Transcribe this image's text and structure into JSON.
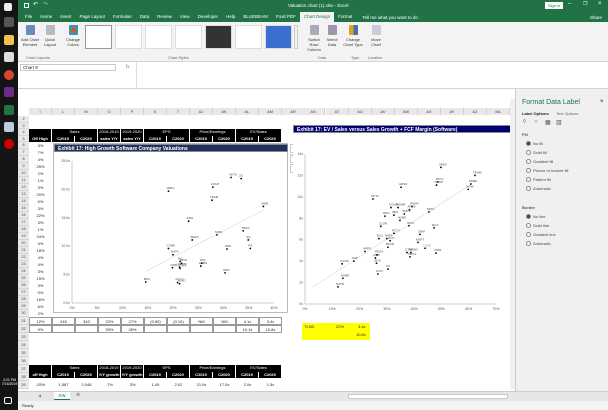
{
  "window": {
    "title": "Valuation chart (1).xlsx - Excel",
    "signin": "Sign in",
    "share": "Share"
  },
  "taskbar": {
    "time": "3:21 PM",
    "date": "7/16/2019"
  },
  "tabs": [
    "File",
    "Home",
    "Insert",
    "Page Layout",
    "Formulas",
    "Data",
    "Review",
    "View",
    "Developer",
    "Help",
    "BLUEBEAM",
    "Foxit PDF",
    "Chart Design",
    "Format"
  ],
  "active_tab": "Chart Design",
  "tell_me": "Tell me what you want to do",
  "ribbon": {
    "add_chart_element": "Add Chart Element",
    "quick_layout": "Quick Layout",
    "change_colors": "Change Colors",
    "switch_row_col": "Switch Row/ Column",
    "select_data": "Select Data",
    "change_chart_type": "Change Chart Type",
    "move_chart": "Move Chart",
    "groups": {
      "layouts": "Chart Layouts",
      "styles": "Chart Styles",
      "data": "Data",
      "type": "Type",
      "location": "Location"
    }
  },
  "formula": {
    "name_box": "Chart 9",
    "fx": "fx"
  },
  "columns_left": [
    "I",
    "L",
    "M",
    "O",
    "P",
    "S",
    "T",
    "AJ",
    "AK",
    "AL",
    "AM",
    "AR"
  ],
  "columns_right": [
    "AS",
    "AT",
    "AU",
    "AV",
    "AW",
    "AX",
    "AY",
    "AZ",
    "BA"
  ],
  "table_top": {
    "groups": [
      "",
      "Sales",
      "2018-2019",
      "2019-2020",
      "EPS",
      "Price/Earnings",
      "EV/Sales"
    ],
    "headers": [
      "Off High",
      "C2019",
      "C2020",
      "sales Y/Y",
      "sales Y/Y",
      "C2019",
      "C2020",
      "C2019",
      "C2020",
      "C2019",
      "C2020"
    ]
  },
  "off_high": [
    "3%",
    "7%",
    "4%",
    "25%",
    "2%",
    "1%",
    "3%",
    "20%",
    "0%",
    "3%",
    "22%",
    "3%",
    "1%",
    "24%",
    "4%",
    "18%",
    "4%",
    "4%",
    "3%",
    "15%",
    "3%",
    "0%",
    "16%",
    "6%",
    "2%"
  ],
  "row31": [
    "12%",
    "245",
    "343",
    "22%",
    "27%",
    "(0.90)",
    "(0.10)",
    "NM",
    "NM",
    "4.1x",
    "3.4x"
  ],
  "row32": [
    "9%",
    "",
    "",
    "33%",
    "26%",
    "",
    "",
    "",
    "",
    "10.1x",
    "10.8x"
  ],
  "table_bottom": {
    "groups": [
      "",
      "Sales",
      "2018-2019",
      "2019-2020",
      "EPS",
      "Price/Earnings",
      "EV/Sales"
    ],
    "headers": [
      "off High",
      "C2019",
      "C2020",
      "Y/Y growth",
      "Y/Y growth",
      "C2019",
      "C2020",
      "C2019",
      "C2020",
      "C2019",
      "C2020"
    ],
    "row": [
      "-25%",
      "1,587",
      "2,048",
      "-7%",
      "3%",
      "1.49",
      "2.02",
      "21.9x",
      "17.0x",
      "2.0x",
      "1.5x"
    ]
  },
  "highlight": {
    "ticker": "TLND",
    "growth": "22%",
    "ev1": "3.4x",
    "ev2": "10.8x",
    "color": "#ffff00"
  },
  "chart_data": [
    {
      "type": "scatter",
      "title": "Exhibit 17: High Growth Software Company Valuations",
      "xlim": [
        0,
        40
      ],
      "ylim": [
        0,
        25
      ],
      "xticks": [
        "0%",
        "5%",
        "10%",
        "15%",
        "20%",
        "25%",
        "30%",
        "35%",
        "40%"
      ],
      "yticks": [
        "0.0x",
        "5.0x",
        "10.0x",
        "15.0x",
        "20.0x",
        "25.0x"
      ],
      "points": [
        {
          "label": "VEEV",
          "x": 19.1,
          "y": 19.7
        },
        {
          "label": "OKTA",
          "x": 31.5,
          "y": 22.1
        },
        {
          "label": "ZS",
          "x": 33.5,
          "y": 21.9
        },
        {
          "label": "COUP",
          "x": 27.9,
          "y": 20.4
        },
        {
          "label": "TEAM",
          "x": 27.7,
          "y": 18.1
        },
        {
          "label": "MDB",
          "x": 37.9,
          "y": 17.0
        },
        {
          "label": "RNG",
          "x": 23.1,
          "y": 14.4
        },
        {
          "label": "NOW",
          "x": 28.7,
          "y": 12.0
        },
        {
          "label": "TWLO",
          "x": 33.9,
          "y": 12.7
        },
        {
          "label": "SQ",
          "x": 34.9,
          "y": 11.1
        },
        {
          "label": "PS",
          "x": 35.3,
          "y": 9.6
        },
        {
          "label": "ZEN",
          "x": 30.7,
          "y": 9.5
        },
        {
          "label": "WDAY",
          "x": 23.8,
          "y": 11.1
        },
        {
          "label": "CYBR",
          "x": 19.1,
          "y": 9.6
        },
        {
          "label": "DATA",
          "x": 20.0,
          "y": 8.5
        },
        {
          "label": "NC",
          "x": 21.4,
          "y": 7.3
        },
        {
          "label": "SPLK",
          "x": 21.7,
          "y": 7.0
        },
        {
          "label": "WIX",
          "x": 25.7,
          "y": 7.0
        },
        {
          "label": "HUBS",
          "x": 25.5,
          "y": 6.5
        },
        {
          "label": "CRM",
          "x": 19.9,
          "y": 6.2
        },
        {
          "label": "NEWR",
          "x": 21.3,
          "y": 6.3
        },
        {
          "label": "NTNX",
          "x": 21.4,
          "y": 6.1
        },
        {
          "label": "INST",
          "x": 30.3,
          "y": 5.3
        },
        {
          "label": "PCTY",
          "x": 20.9,
          "y": 3.6
        },
        {
          "label": "TLND",
          "x": 21.3,
          "y": 3.4
        },
        {
          "label": "BOX",
          "x": 14.6,
          "y": 3.7
        }
      ],
      "trendline": [
        [
          14.6,
          5.6
        ],
        [
          38.0,
          16.4
        ]
      ]
    },
    {
      "type": "scatter",
      "title": "Exhibit 17: EV / Sales versus Sales Growth + FCF Margin (Software)",
      "xlim": [
        0,
        70
      ],
      "ylim": [
        0,
        14
      ],
      "xticks": [
        "0%",
        "10%",
        "20%",
        "30%",
        "40%",
        "50%",
        "60%",
        "70%"
      ],
      "yticks": [
        "0x",
        "2x",
        "4x",
        "6x",
        "8x",
        "10x",
        "12x",
        "14x"
      ],
      "points": [
        {
          "label": "VEEV",
          "x": 49.8,
          "y": 12.75
        },
        {
          "label": "TEAM",
          "x": 62.3,
          "y": 12.0
        },
        {
          "label": "PAYC",
          "x": 48.7,
          "y": 11.4
        },
        {
          "label": "SHOP",
          "x": 48.2,
          "y": 11.1
        },
        {
          "label": "ADSK",
          "x": 35.2,
          "y": 10.9
        },
        {
          "label": "ADBE",
          "x": 60.8,
          "y": 11.2
        },
        {
          "label": "NOW",
          "x": 59.8,
          "y": 10.7
        },
        {
          "label": "OKTA",
          "x": 24.9,
          "y": 9.8
        },
        {
          "label": "COUP",
          "x": 31.5,
          "y": 9.0
        },
        {
          "label": "NEWR",
          "x": 34.1,
          "y": 9.0
        },
        {
          "label": "WDAY",
          "x": 39.2,
          "y": 9.1
        },
        {
          "label": "SPLK",
          "x": 45.4,
          "y": 8.6
        },
        {
          "label": "RNG",
          "x": 29.3,
          "y": 8.2
        },
        {
          "label": "ZEN",
          "x": 32.6,
          "y": 8.3
        },
        {
          "label": "SNPS",
          "x": 36.4,
          "y": 8.4
        },
        {
          "label": "ANSS",
          "x": 38.3,
          "y": 8.8
        },
        {
          "label": "CLDR",
          "x": 27.8,
          "y": 7.25
        },
        {
          "label": "HUBS",
          "x": 34.8,
          "y": 7.8
        },
        {
          "label": "INTU",
          "x": 38.1,
          "y": 7.3
        },
        {
          "label": "PCTY",
          "x": 32.6,
          "y": 6.6
        },
        {
          "label": "DATA",
          "x": 30.0,
          "y": 6.1
        },
        {
          "label": "ELLI",
          "x": 27.1,
          "y": 6.1
        },
        {
          "label": "ULTI",
          "x": 31.2,
          "y": 5.9
        },
        {
          "label": "MSFT",
          "x": 41.4,
          "y": 5.75
        },
        {
          "label": "CRM",
          "x": 42.1,
          "y": 6.5
        },
        {
          "label": "RHT",
          "x": 47.3,
          "y": 7.1
        },
        {
          "label": "TLND",
          "x": 44.0,
          "y": 5.2,
          "highlight": true
        },
        {
          "label": "VMW",
          "x": 48.0,
          "y": 4.75
        },
        {
          "label": "ORCL",
          "x": 38.5,
          "y": 4.4
        },
        {
          "label": "MDSO",
          "x": 38.8,
          "y": 4.8
        },
        {
          "label": "CTXS",
          "x": 37.4,
          "y": 4.8
        },
        {
          "label": "BLKB",
          "x": 30.4,
          "y": 5.3
        },
        {
          "label": "APPS",
          "x": 22.0,
          "y": 4.9
        },
        {
          "label": "PEGA",
          "x": 26.4,
          "y": 4.6
        },
        {
          "label": "MDP",
          "x": 25.8,
          "y": 4.3
        },
        {
          "label": "BOX",
          "x": 26.2,
          "y": 3.8
        },
        {
          "label": "SAP",
          "x": 17.9,
          "y": 4.0
        },
        {
          "label": "CVOD",
          "x": 13.6,
          "y": 3.75
        },
        {
          "label": "CA",
          "x": 30.4,
          "y": 3.25
        },
        {
          "label": "SABR",
          "x": 13.9,
          "y": 2.4
        },
        {
          "label": "CVLT",
          "x": 26.7,
          "y": 2.8
        },
        {
          "label": "NATR",
          "x": 12.1,
          "y": 1.6
        }
      ],
      "trendline": [
        [
          3,
          1.6
        ],
        [
          61,
          11.2
        ]
      ]
    }
  ],
  "pane": {
    "title": "Format Data Label",
    "label_options": "Label Options",
    "text_options": "Text Options",
    "fill": "Fill",
    "fill_options": [
      "No fill",
      "Solid fill",
      "Gradient fill",
      "Picture or texture fill",
      "Pattern fill",
      "Automatic"
    ],
    "border": "Border",
    "border_options": [
      "No line",
      "Solid line",
      "Gradient line",
      "Automatic"
    ],
    "close": "×"
  },
  "sheet": {
    "tab": "SW",
    "status": "Ready"
  }
}
